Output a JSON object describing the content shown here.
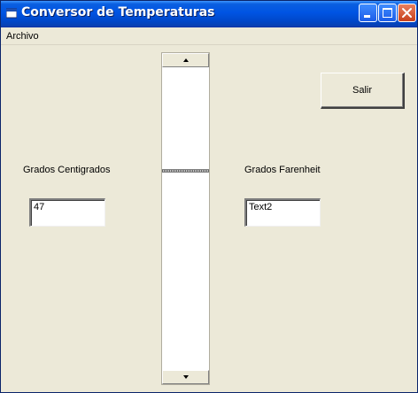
{
  "window": {
    "title": "Conversor de Temperaturas",
    "controls": [
      "minimize-icon",
      "maximize-icon",
      "close-icon"
    ]
  },
  "menu": {
    "items": [
      {
        "label": "Archivo"
      }
    ]
  },
  "form": {
    "celsius_label": "Grados Centigrados",
    "celsius_value": "47",
    "fahrenheit_label": "Grados Farenheit",
    "fahrenheit_value": "Text2",
    "exit_button": "Salir"
  },
  "scrollbar": {
    "orientation": "vertical",
    "position_fraction": 0.34
  },
  "colors": {
    "titlebar": "#0054e3",
    "face": "#ece9d8",
    "close_button": "#c7401c"
  }
}
